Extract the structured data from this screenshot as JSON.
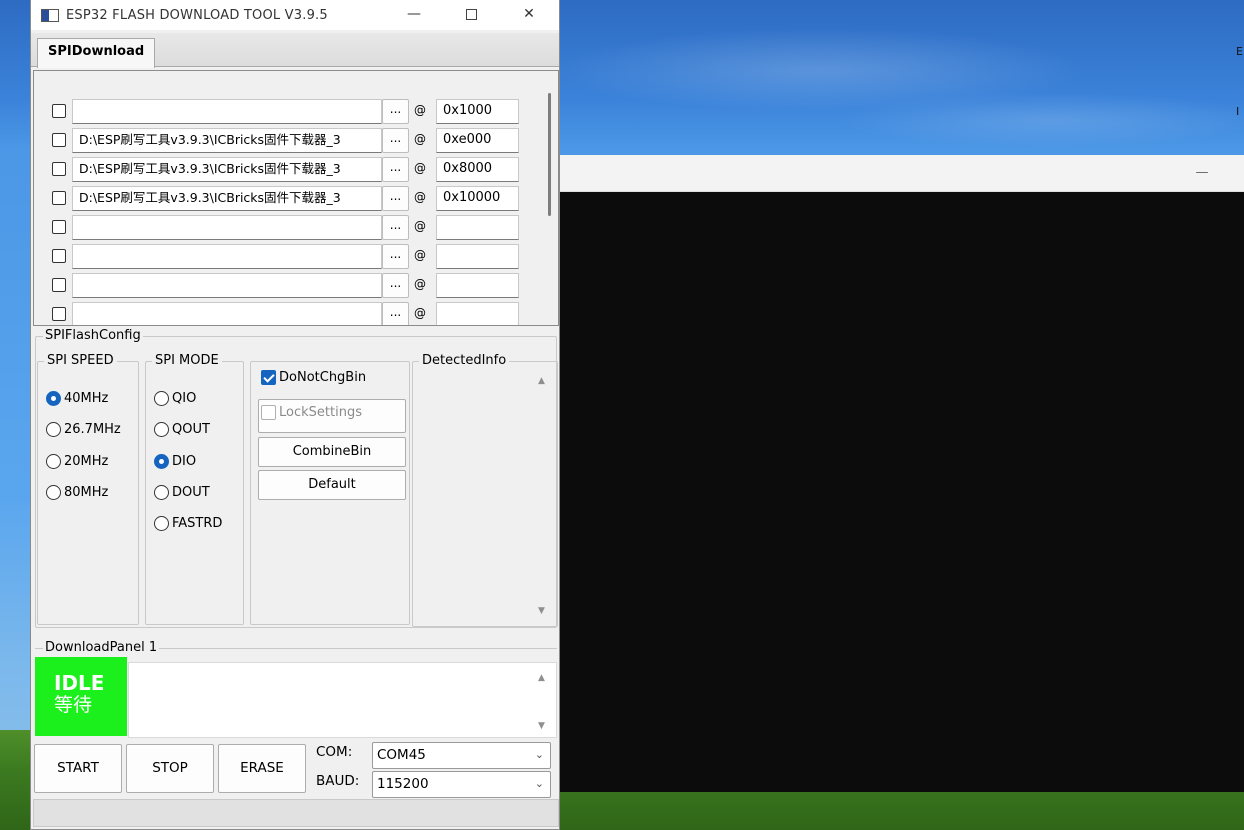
{
  "window": {
    "title": "ESP32 FLASH DOWNLOAD TOOL V3.9.5",
    "minimize": "—",
    "close": "✕"
  },
  "tab": {
    "label": "SPIDownload"
  },
  "files": [
    {
      "checked": false,
      "path": "",
      "browse": "...",
      "at": "@",
      "address": "0x1000"
    },
    {
      "checked": false,
      "path": "D:\\ESP刷写工具v3.9.3\\ICBricks固件下载器_3",
      "browse": "...",
      "at": "@",
      "address": "0xe000"
    },
    {
      "checked": false,
      "path": "D:\\ESP刷写工具v3.9.3\\ICBricks固件下载器_3",
      "browse": "...",
      "at": "@",
      "address": "0x8000"
    },
    {
      "checked": false,
      "path": "D:\\ESP刷写工具v3.9.3\\ICBricks固件下载器_3",
      "browse": "...",
      "at": "@",
      "address": "0x10000"
    },
    {
      "checked": false,
      "path": "",
      "browse": "...",
      "at": "@",
      "address": ""
    },
    {
      "checked": false,
      "path": "",
      "browse": "...",
      "at": "@",
      "address": ""
    },
    {
      "checked": false,
      "path": "",
      "browse": "...",
      "at": "@",
      "address": ""
    },
    {
      "checked": false,
      "path": "",
      "browse": "...",
      "at": "@",
      "address": ""
    }
  ],
  "spi_config": {
    "title": "SPIFlashConfig",
    "speed": {
      "title": "SPI SPEED",
      "options": [
        "40MHz",
        "26.7MHz",
        "20MHz",
        "80MHz"
      ],
      "selected": "40MHz"
    },
    "mode": {
      "title": "SPI MODE",
      "options": [
        "QIO",
        "QOUT",
        "DIO",
        "DOUT",
        "FASTRD"
      ],
      "selected": "DIO"
    },
    "do_not_chg_bin": {
      "label": "DoNotChgBin",
      "checked": true
    },
    "lock_settings": {
      "label": "LockSettings",
      "checked": false
    },
    "combine_bin": "CombineBin",
    "default": "Default",
    "detected_info": {
      "title": "DetectedInfo"
    }
  },
  "download_panel": {
    "title": "DownloadPanel 1",
    "status_en": "IDLE",
    "status_zh": "等待",
    "status_color": "#1cf01c",
    "start": "START",
    "stop": "STOP",
    "erase": "ERASE",
    "com_label": "COM:",
    "com_value": "COM45",
    "baud_label": "BAUD:",
    "baud_value": "115200"
  },
  "terminal": {
    "minimize": "—"
  }
}
